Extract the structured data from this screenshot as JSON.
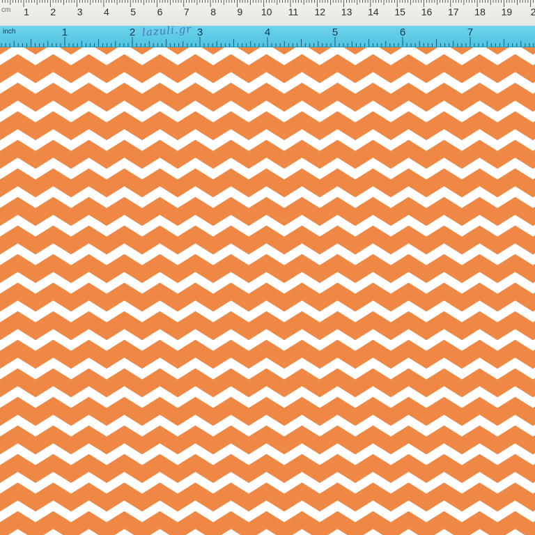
{
  "image": {
    "description_colors": {
      "fabric_orange": "#ef8845",
      "chevron_white": "#ffffff",
      "cm_ruler": "#efefea",
      "inch_ruler": "#5ecbe6"
    },
    "pattern": "chevron-zigzag"
  },
  "ruler_cm": {
    "unit_label": "cm",
    "numbers": [
      "1",
      "2",
      "3",
      "4",
      "5",
      "6",
      "7",
      "8",
      "9",
      "10",
      "11",
      "12",
      "13",
      "14",
      "15",
      "16",
      "17",
      "18",
      "19",
      "2"
    ]
  },
  "ruler_inch": {
    "unit_label": "inch",
    "numbers": [
      "1",
      "2",
      "3",
      "4",
      "5",
      "6",
      "7"
    ],
    "handwritten_mark": "lazuli.gr"
  }
}
